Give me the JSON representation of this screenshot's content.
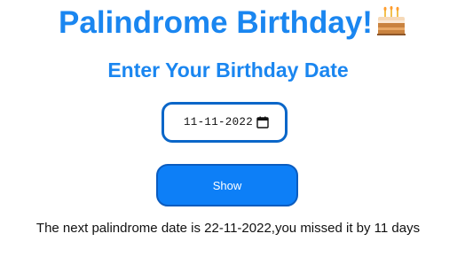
{
  "header": {
    "title": "Palindrome Birthday!",
    "title_icon": "birthday-cake-icon",
    "title_color": "#1a86f0"
  },
  "form": {
    "subtitle": "Enter Your Birthday Date",
    "date_value": "11-11-2022",
    "date_icon": "calendar-icon",
    "show_label": "Show",
    "button_color": "#0d7ff7"
  },
  "output": {
    "message": "The next palindrome date is 22-11-2022,you missed it by 11 days"
  }
}
